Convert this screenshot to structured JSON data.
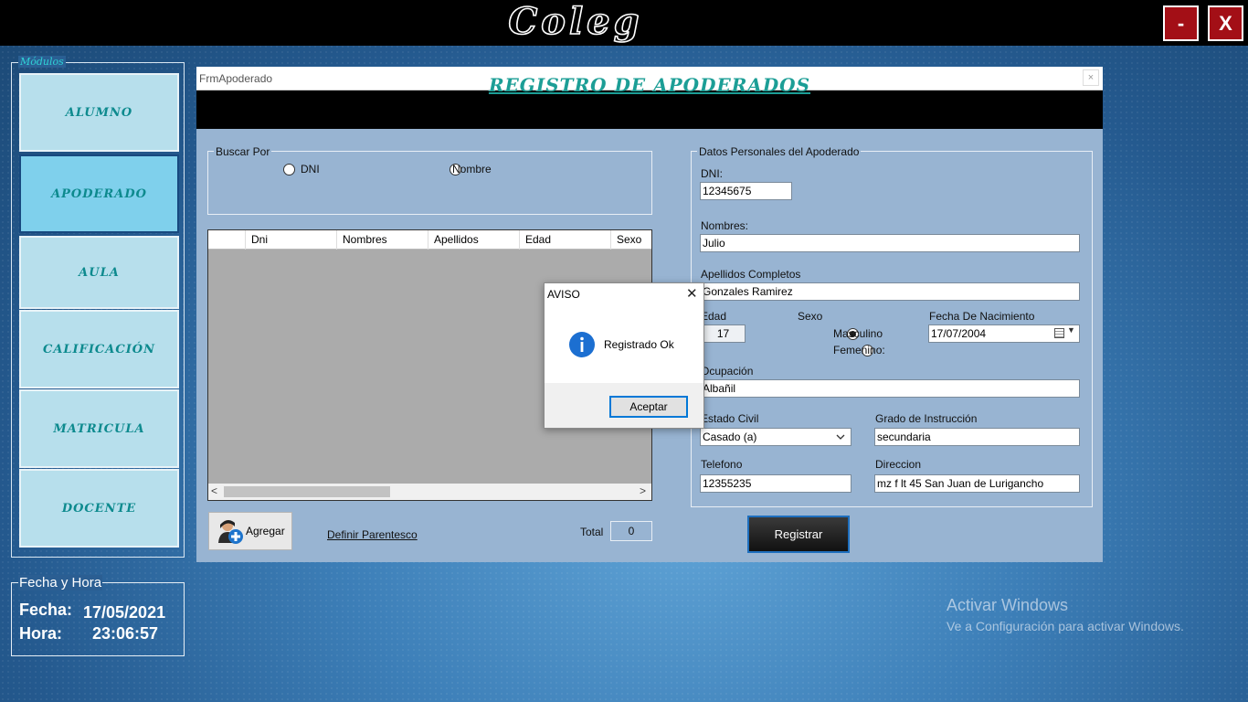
{
  "app": {
    "logo_text": "Coleg",
    "minimize_label": "-",
    "close_label": "X"
  },
  "sidebar": {
    "legend": "Módulos",
    "items": [
      {
        "label": "ALUMNO"
      },
      {
        "label": "APODERADO",
        "active": true
      },
      {
        "label": "AULA"
      },
      {
        "label": "CALIFICACIÓN"
      },
      {
        "label": "MATRICULA"
      },
      {
        "label": "DOCENTE"
      }
    ]
  },
  "datetime": {
    "legend": "Fecha y Hora",
    "fecha_label": "Fecha:",
    "fecha_value": "17/05/2021",
    "hora_label": "Hora:",
    "hora_value": "23:06:57"
  },
  "form": {
    "window_title": "FrmApoderado",
    "close_label": "×",
    "header_title": "REGISTRO DE APODERADOS",
    "search": {
      "legend": "Buscar Por",
      "option_dni": "DNI",
      "option_nombre": "Nombre"
    },
    "grid": {
      "columns": [
        "Dni",
        "Nombres",
        "Apellidos",
        "Edad",
        "Sexo"
      ],
      "scroll_left": "<",
      "scroll_right": ">"
    },
    "agregar_label": "Agregar",
    "parentesco_link": "Definir Parentesco",
    "total_label": "Total",
    "total_value": "0",
    "personal": {
      "legend": "Datos Personales del Apoderado",
      "dni_label": "DNI:",
      "dni_value": "12345675",
      "nombres_label": "Nombres:",
      "nombres_value": "Julio",
      "apellidos_label": "Apellidos Completos",
      "apellidos_value": "Gonzales Ramirez",
      "edad_label": "Edad",
      "edad_value": "17",
      "sexo_label": "Sexo",
      "sexo_masculino": "Masculino",
      "sexo_femenino": "Femenino:",
      "fecha_nac_label": "Fecha De Nacimiento",
      "fecha_nac_value": "17/07/2004",
      "ocupacion_label": "Ocupación",
      "ocupacion_value": "Albañil",
      "estado_civil_label": "Estado Civil",
      "estado_civil_value": "Casado (a)",
      "grado_label": "Grado de Instrucción",
      "grado_value": "secundaria",
      "telefono_label": "Telefono",
      "telefono_value": "12355235",
      "direccion_label": "Direccion",
      "direccion_value": "mz f lt 45 San Juan de Lurigancho"
    },
    "registrar_label": "Registrar"
  },
  "dialog": {
    "title": "AVISO",
    "close_label": "✕",
    "message": "Registrado Ok",
    "ok_label": "Aceptar"
  },
  "watermark": {
    "title": "Activar Windows",
    "subtitle": "Ve a Configuración para activar Windows."
  }
}
